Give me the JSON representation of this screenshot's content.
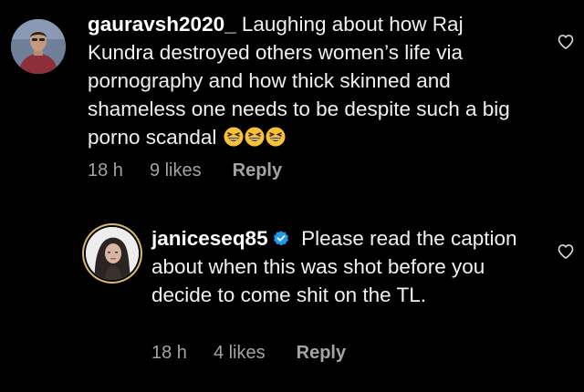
{
  "comments": [
    {
      "username": "gauravsh2020_",
      "text": "Laughing about how Raj Kundra destroyed others women’s life via pornography and how thick skinned and shameless one needs to be despite such a big  porno scandal",
      "emojis": [
        "grinning-squinting-face",
        "grinning-squinting-face",
        "grinning-squinting-face"
      ],
      "time": "18 h",
      "likes": "9 likes",
      "reply_label": "Reply"
    },
    {
      "username": "janiceseq85",
      "verified": true,
      "text": "Please read the caption about when this was shot before you decide to come shit on the TL.",
      "time": "18 h",
      "likes": "4 likes",
      "reply_label": "Reply"
    }
  ],
  "icons": {
    "like": "heart-outline-icon",
    "verified": "verified-badge-icon"
  },
  "colors": {
    "background": "#000000",
    "text": "#f0f0f0",
    "meta": "#a3a3a3",
    "verified": "#1d9bf0",
    "story_ring": "#d9b86a"
  }
}
